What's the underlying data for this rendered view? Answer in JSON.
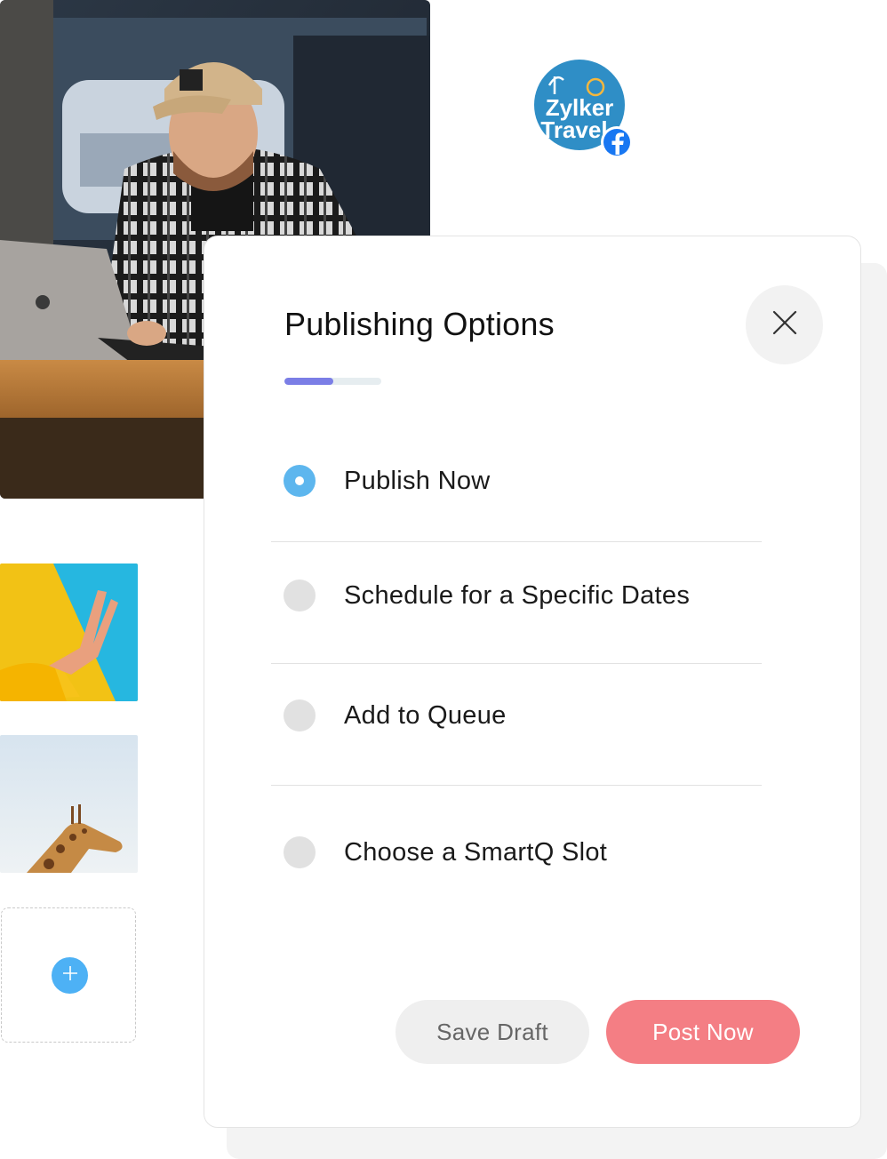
{
  "brand": {
    "logo_line1": "Zylker",
    "logo_line2": "Travel",
    "network_icon": "facebook-icon",
    "colors": {
      "logo_bg": "#2f8ec6",
      "facebook": "#1877f2"
    }
  },
  "media": {
    "hero_image": "man-with-laptop",
    "thumbnails": [
      "peace-sign-hand",
      "giraffe"
    ],
    "add_icon": "plus-icon"
  },
  "modal": {
    "title": "Publishing Options",
    "close_icon": "close-icon",
    "progress": 0.5,
    "options": [
      {
        "label": "Publish Now",
        "selected": true
      },
      {
        "label": "Schedule for a Specific Dates",
        "selected": false
      },
      {
        "label": "Add to Queue",
        "selected": false
      },
      {
        "label": "Choose a SmartQ Slot",
        "selected": false
      }
    ],
    "buttons": {
      "save_draft": "Save Draft",
      "post_now": "Post Now"
    },
    "colors": {
      "accent": "#5db6ee",
      "progress": "#7b7ee6",
      "post_button": "#f47e84"
    }
  }
}
